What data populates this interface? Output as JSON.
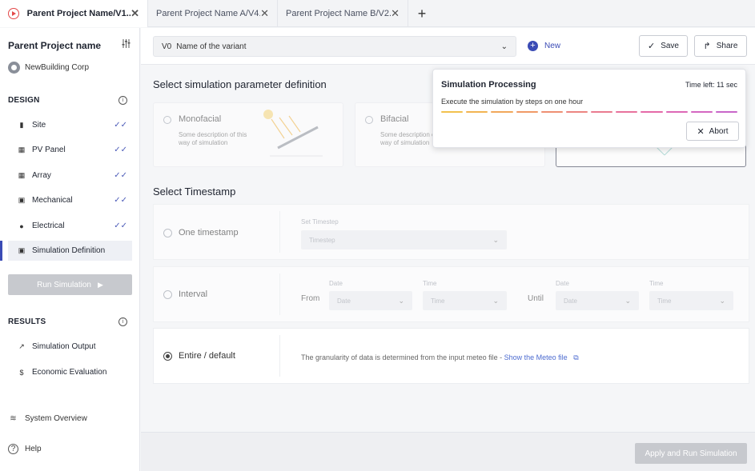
{
  "tabs": [
    {
      "title": "Parent Project Name/V1...",
      "active": true
    },
    {
      "title": "Parent Project Name A/V4...",
      "active": false
    },
    {
      "title": "Parent Project Name B/V2...",
      "active": false
    }
  ],
  "tabs_add": "+",
  "sidebar": {
    "project_name": "Parent Project name",
    "company": "NewBuilding Corp",
    "design_title": "DESIGN",
    "design_items": [
      {
        "label": "Site",
        "icon": "map-icon",
        "done": true
      },
      {
        "label": "PV Panel",
        "icon": "panel-icon",
        "done": true
      },
      {
        "label": "Array",
        "icon": "grid-icon",
        "done": true
      },
      {
        "label": "Mechanical",
        "icon": "chip-icon",
        "done": true
      },
      {
        "label": "Electrical",
        "icon": "bolt-icon",
        "done": true
      },
      {
        "label": "Simulation Definition",
        "icon": "calendar-icon",
        "done": false
      }
    ],
    "run_label": "Run Simulation",
    "results_title": "RESULTS",
    "results_items": [
      {
        "label": "Simulation Output",
        "icon": "chart-icon"
      },
      {
        "label": "Economic Evaluation",
        "icon": "dollar-icon"
      }
    ],
    "system_overview": "System Overview",
    "help": "Help"
  },
  "header": {
    "variant_code": "V0",
    "variant_name": "Name of the variant",
    "new_label": "New",
    "save_label": "Save",
    "share_label": "Share"
  },
  "main": {
    "param_title": "Select simulation parameter definition",
    "cards": [
      {
        "title": "Monofacial",
        "desc": "Some description of this way of simulation"
      },
      {
        "title": "Bifacial",
        "desc": "Some description of this way of simulation"
      }
    ],
    "timestamp_title": "Select Timestamp",
    "one_timestamp": {
      "label": "One timestamp",
      "set_label": "Set Timestep",
      "select_placeholder": "Timestep"
    },
    "interval": {
      "label": "Interval",
      "from": "From",
      "until": "Until",
      "date_label": "Date",
      "time_label": "Time",
      "date_placeholder": "Date",
      "time_placeholder": "Time"
    },
    "entire": {
      "label": "Entire / default",
      "text": "The granularity of data is determined from the input meteo file - ",
      "link": "Show the Meteo file"
    }
  },
  "footer": {
    "apply_label": "Apply and Run Simulation"
  },
  "popup": {
    "title": "Simulation Processing",
    "time_left": "Time left: 11 sec",
    "description": "Execute the simulation by steps on one hour",
    "abort_label": "Abort",
    "segment_colors": [
      "#f2c14e",
      "#f2b452",
      "#f1a85a",
      "#f09a66",
      "#ee8f73",
      "#ec8581",
      "#ea7b8f",
      "#e8729c",
      "#e56aa8",
      "#dd68b6",
      "#d467c1",
      "#c866c9"
    ]
  },
  "colors": {
    "accent": "#3a4bb5",
    "check": "#4c5bb8",
    "disabled_button": "#c7c9ce",
    "link": "#4c6bd0",
    "tab_logo": "#e34848"
  }
}
